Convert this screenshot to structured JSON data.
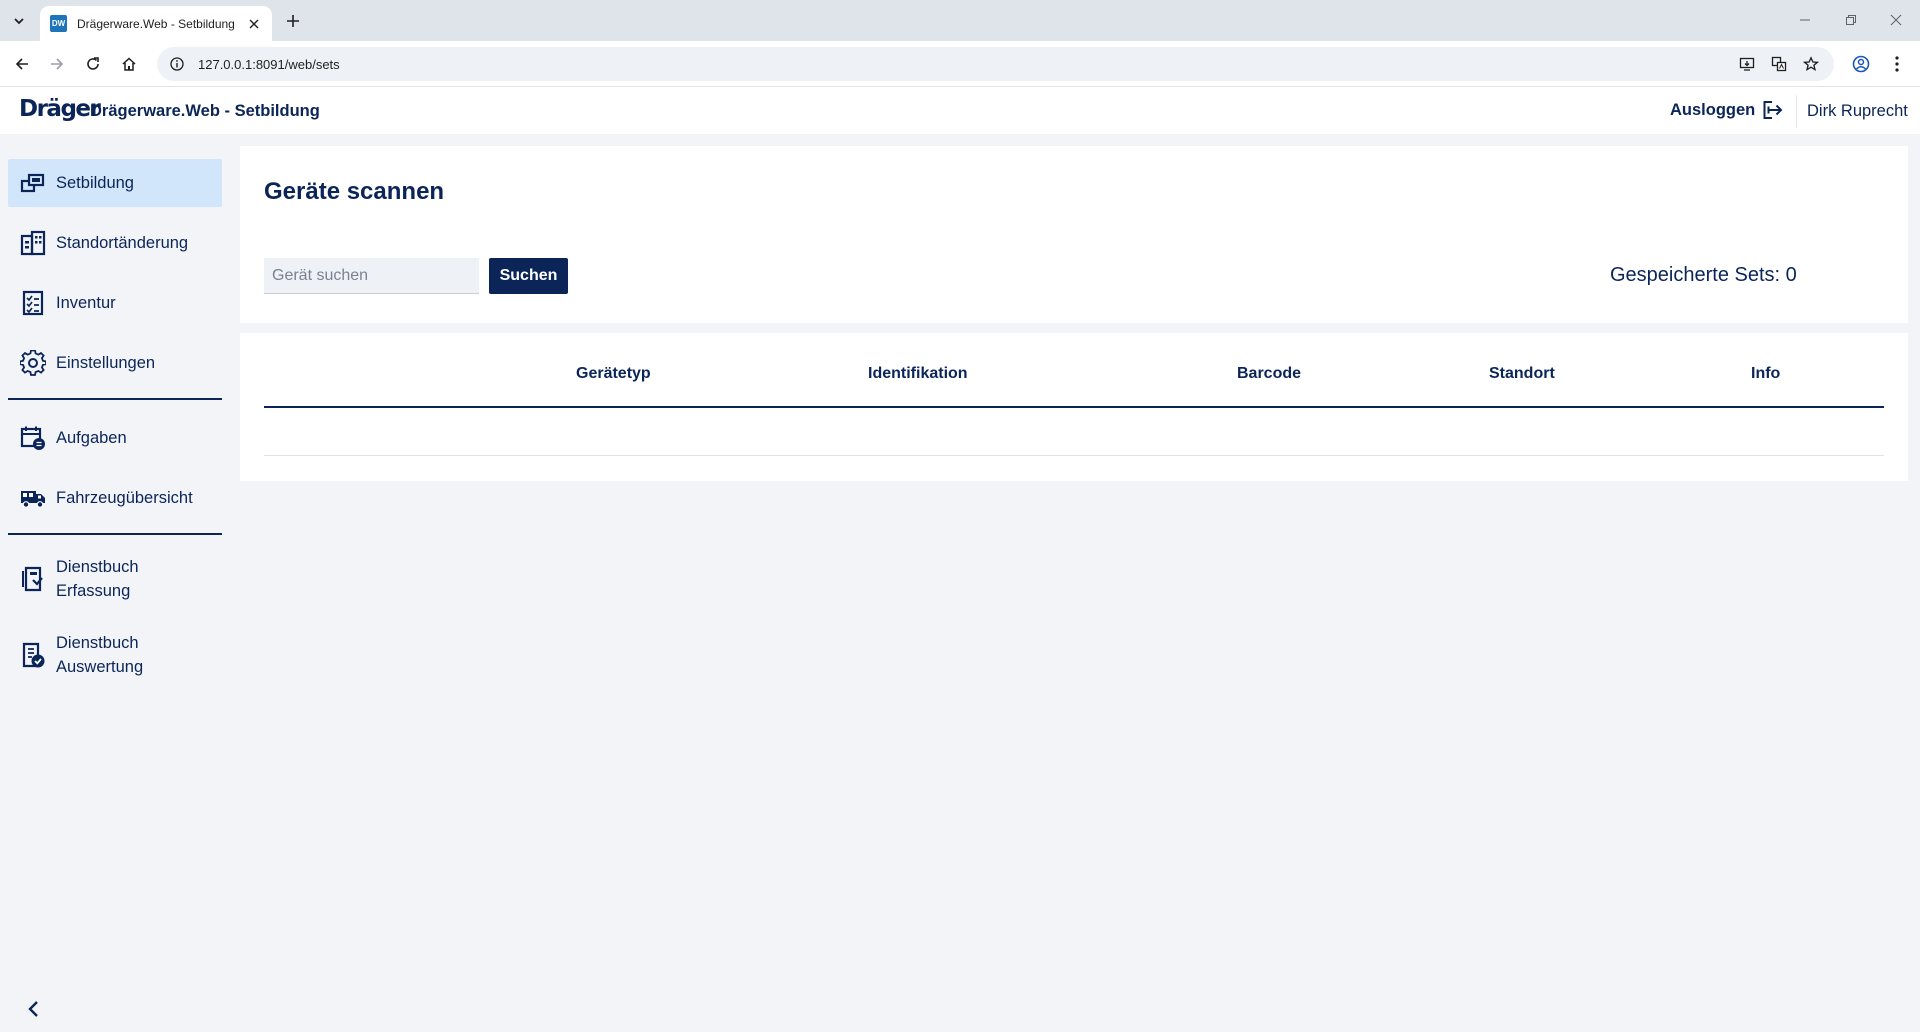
{
  "browser": {
    "tab_title": "Drägerware.Web - Setbildung",
    "favicon_text": "DW",
    "url": "127.0.0.1:8091/web/sets"
  },
  "header": {
    "logo": "Dräger",
    "app_title": "Drägerware.Web - Setbildung",
    "logout_label": "Ausloggen",
    "user_name": "Dirk Ruprecht"
  },
  "sidebar": {
    "items": [
      {
        "label": "Setbildung",
        "icon": "sets-icon",
        "active": true
      },
      {
        "label": "Standortänderung",
        "icon": "building-icon"
      },
      {
        "label": "Inventur",
        "icon": "checklist-icon"
      },
      {
        "label": "Einstellungen",
        "icon": "gear-icon"
      },
      {
        "label": "Aufgaben",
        "icon": "calendar-tasks-icon"
      },
      {
        "label": "Fahrzeugübersicht",
        "icon": "truck-icon"
      },
      {
        "label": "Dienstbuch",
        "label2": "Erfassung",
        "icon": "logbook-edit-icon"
      },
      {
        "label": "Dienstbuch",
        "label2": "Auswertung",
        "icon": "logbook-check-icon"
      }
    ]
  },
  "main": {
    "title": "Geräte scannen",
    "search_placeholder": "Gerät suchen",
    "search_button": "Suchen",
    "saved_sets": "Gespeicherte Sets: 0",
    "table": {
      "headers": [
        "Gerätetyp",
        "Identifikation",
        "Barcode",
        "Standort",
        "Info"
      ],
      "rows": []
    }
  },
  "colors": {
    "primary": "#0b2559",
    "active_nav": "#d2e6fb",
    "page_bg": "#f3f4f8"
  }
}
